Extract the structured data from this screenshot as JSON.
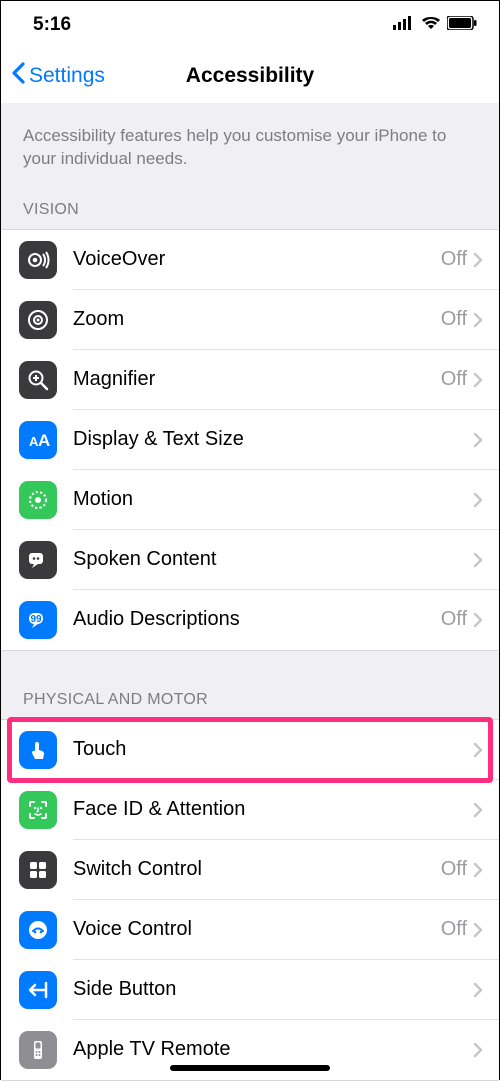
{
  "status": {
    "time": "5:16"
  },
  "nav": {
    "back": "Settings",
    "title": "Accessibility"
  },
  "intro": "Accessibility features help you customise your iPhone to your individual needs.",
  "sections": {
    "vision": {
      "header": "VISION"
    },
    "motor": {
      "header": "PHYSICAL AND MOTOR"
    }
  },
  "rows": {
    "voiceover": {
      "label": "VoiceOver",
      "value": "Off"
    },
    "zoom": {
      "label": "Zoom",
      "value": "Off"
    },
    "magnifier": {
      "label": "Magnifier",
      "value": "Off"
    },
    "display": {
      "label": "Display & Text Size",
      "value": ""
    },
    "motion": {
      "label": "Motion",
      "value": ""
    },
    "spoken": {
      "label": "Spoken Content",
      "value": ""
    },
    "audio": {
      "label": "Audio Descriptions",
      "value": "Off"
    },
    "touch": {
      "label": "Touch",
      "value": ""
    },
    "faceid": {
      "label": "Face ID & Attention",
      "value": ""
    },
    "switch": {
      "label": "Switch Control",
      "value": "Off"
    },
    "voice": {
      "label": "Voice Control",
      "value": "Off"
    },
    "side": {
      "label": "Side Button",
      "value": ""
    },
    "appletv": {
      "label": "Apple TV Remote",
      "value": ""
    }
  }
}
